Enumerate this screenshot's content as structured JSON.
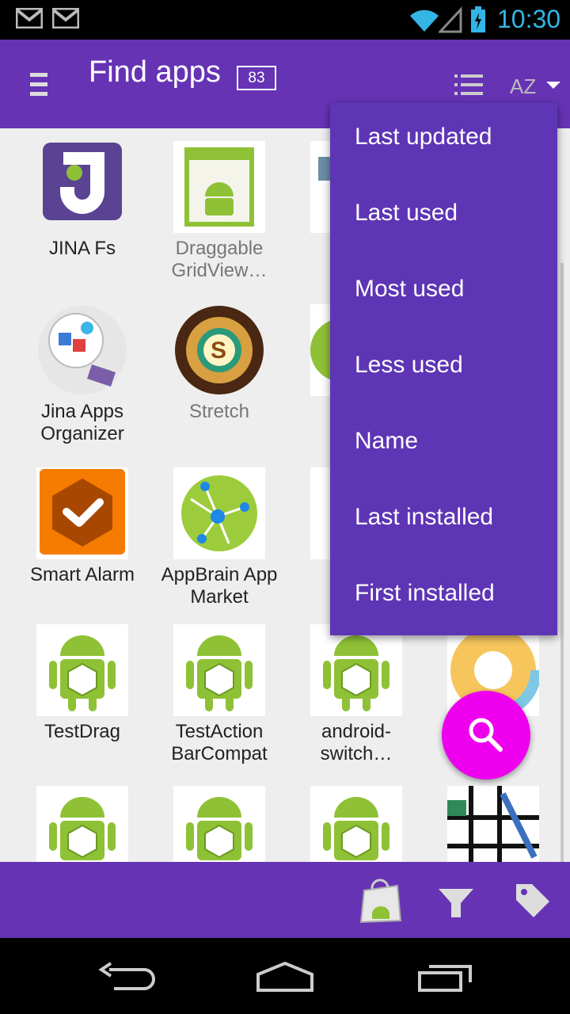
{
  "status": {
    "time": "10:30"
  },
  "header": {
    "title": "Find apps",
    "count": "83"
  },
  "apps": [
    {
      "label": "JINA Fs",
      "dim": false
    },
    {
      "label": "Draggable GridView…",
      "dim": true
    },
    {
      "label": "Jina Apps Organizer",
      "dim": false
    },
    {
      "label": "Stretch",
      "dim": true
    },
    {
      "label": "Smart Alarm",
      "dim": false
    },
    {
      "label": "AppBrain App Market",
      "dim": false
    },
    {
      "label": "TestDrag",
      "dim": false
    },
    {
      "label": "TestAction BarCompat",
      "dim": false
    },
    {
      "label": "android-switch…",
      "dim": false
    },
    {
      "label": "",
      "dim": false
    },
    {
      "label": "",
      "dim": false
    },
    {
      "label": "",
      "dim": false
    },
    {
      "label": "",
      "dim": false
    }
  ],
  "sort_menu": {
    "items": [
      "Last updated",
      "Last used",
      "Most used",
      "Less used",
      "Name",
      "Last installed",
      "First installed"
    ]
  },
  "icons": {
    "menu": "hamburger-icon",
    "view": "list-view-icon",
    "sort": "sort-az-icon",
    "search": "search-icon",
    "store": "play-store-icon",
    "filter": "filter-icon",
    "tag": "tag-icon",
    "back": "back-icon",
    "home": "home-icon",
    "recents": "recents-icon"
  },
  "colors": {
    "primary": "#6633b5",
    "menu": "#5e35b5",
    "fab": "#ee00ee",
    "android_green": "#8fc136"
  }
}
